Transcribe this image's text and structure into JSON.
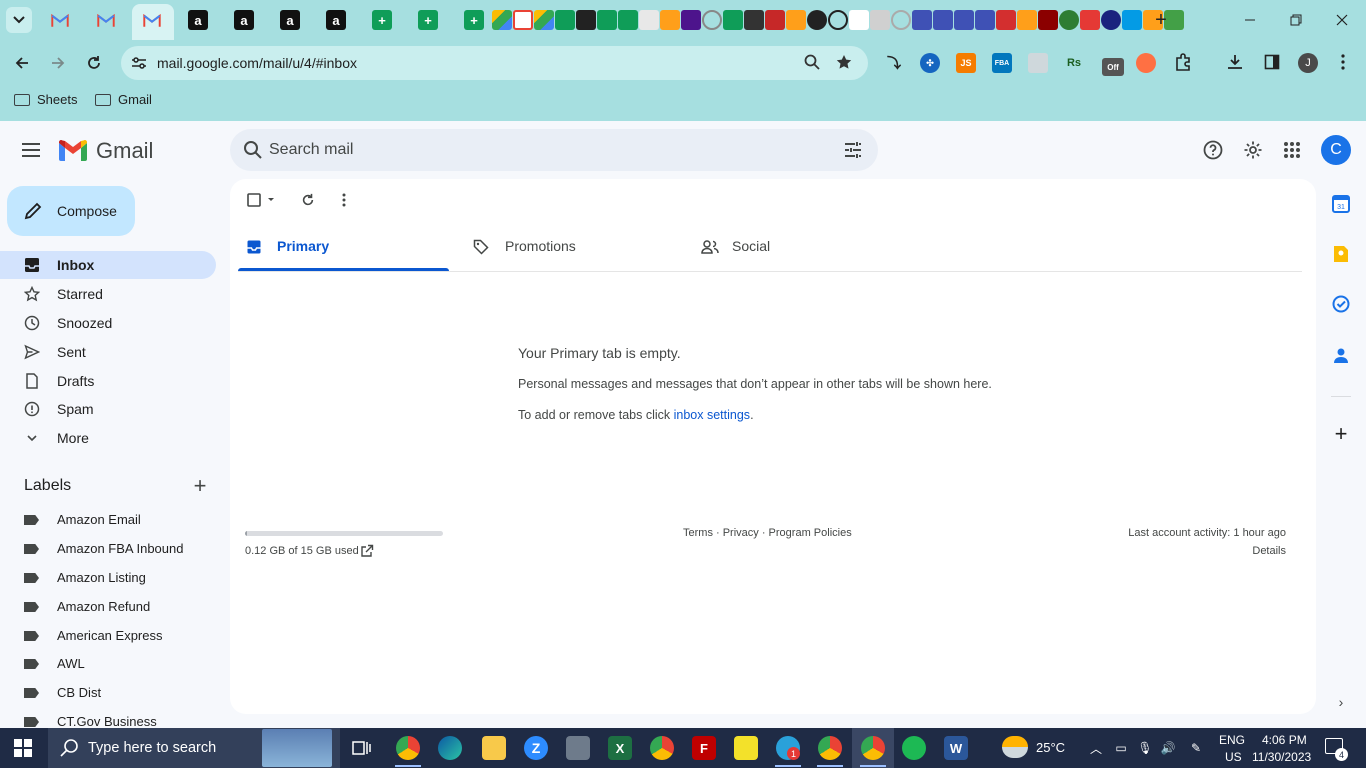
{
  "browser": {
    "url": "mail.google.com/mail/u/4/#inbox",
    "profile_initial": "J",
    "bookmarks": [
      {
        "label": "Sheets"
      },
      {
        "label": "Gmail"
      }
    ],
    "extension_labels": {
      "fba": "FBA",
      "js": "JS",
      "rs": "Rs",
      "off": "Off"
    },
    "tab_favicon_letters": {
      "amazon": "a",
      "sheets": "+"
    }
  },
  "gmail": {
    "brand": "Gmail",
    "search_placeholder": "Search mail",
    "avatar_initial": "C",
    "compose_label": "Compose",
    "nav": [
      {
        "label": "Inbox",
        "icon": "inbox-icon"
      },
      {
        "label": "Starred",
        "icon": "star-icon"
      },
      {
        "label": "Snoozed",
        "icon": "clock-icon"
      },
      {
        "label": "Sent",
        "icon": "send-icon"
      },
      {
        "label": "Drafts",
        "icon": "draft-icon"
      },
      {
        "label": "Spam",
        "icon": "spam-icon"
      },
      {
        "label": "More",
        "icon": "chevron-down-icon"
      }
    ],
    "labels_title": "Labels",
    "labels": [
      "Amazon Email",
      "Amazon FBA Inbound",
      "Amazon Listing",
      "Amazon Refund",
      "American Express",
      "AWL",
      "CB Dist",
      "CT.Gov Business"
    ],
    "tabs": [
      {
        "label": "Primary",
        "icon": "inbox-icon",
        "active": true
      },
      {
        "label": "Promotions",
        "icon": "tag-icon",
        "active": false
      },
      {
        "label": "Social",
        "icon": "people-icon",
        "active": false
      }
    ],
    "empty": {
      "title": "Your Primary tab is empty.",
      "description": "Personal messages and messages that don’t appear in other tabs will be shown here.",
      "settings_prefix": "To add or remove tabs click ",
      "settings_link": "inbox settings",
      "settings_suffix": "."
    },
    "storage": {
      "used_text": "0.12 GB of 15 GB used",
      "fraction": 0.008
    },
    "footer": {
      "links": "Terms · Privacy · Program Policies",
      "activity": "Last account activity: 1 hour ago",
      "details": "Details"
    }
  },
  "taskbar": {
    "search_placeholder": "Type here to search",
    "weather": "25°C",
    "language": "ENG",
    "region": "US",
    "time": "4:06 PM",
    "date": "11/30/2023",
    "notification_count": "4",
    "telegram_badge": "1"
  },
  "colors": {
    "chrome_bg": "#a6dfe0",
    "accent": "#0b57d0",
    "compose_bg": "#c2e7ff",
    "nav_active_bg": "#d3e3fd",
    "taskbar_bg": "#1f2b45"
  }
}
